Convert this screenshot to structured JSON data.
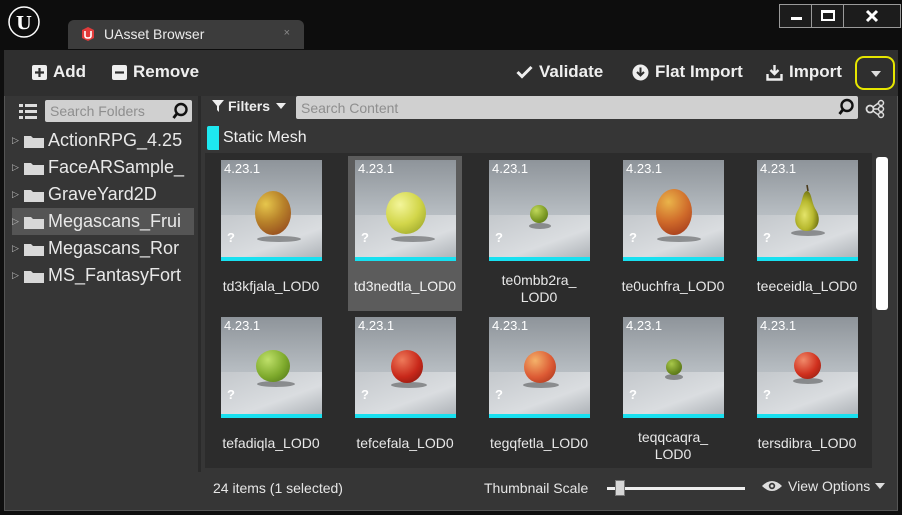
{
  "window": {
    "tab_title": "UAsset Browser",
    "tab_close": "×"
  },
  "toolbar": {
    "add_label": "Add",
    "remove_label": "Remove",
    "validate_label": "Validate",
    "flat_import_label": "Flat Import",
    "import_label": "Import"
  },
  "folders": {
    "search_placeholder": "Search Folders",
    "items": [
      {
        "label": "ActionRPG_4.25"
      },
      {
        "label": "FaceARSample_"
      },
      {
        "label": "GraveYard2D"
      },
      {
        "label": "Megascans_Frui",
        "selected": true
      },
      {
        "label": "Megascans_Ror"
      },
      {
        "label": "MS_FantasyFort"
      }
    ]
  },
  "content": {
    "filters_label": "Filters",
    "search_placeholder": "Search Content",
    "active_filter": "Static Mesh",
    "active_filter_color": "#1ee8f0",
    "assets": [
      {
        "version": "4.23.1",
        "name": "td3kfjala_LOD0",
        "fruit": "mango",
        "selected": false
      },
      {
        "version": "4.23.1",
        "name": "td3nedtla_LOD0",
        "fruit": "yellow-apple",
        "selected": true
      },
      {
        "version": "4.23.1",
        "name": "te0mbb2ra_\nLOD0",
        "fruit": "lime",
        "selected": false
      },
      {
        "version": "4.23.1",
        "name": "te0uchfra_LOD0",
        "fruit": "mango",
        "selected": false
      },
      {
        "version": "4.23.1",
        "name": "teeceidla_LOD0",
        "fruit": "pear",
        "selected": false
      },
      {
        "version": "4.23.1",
        "name": "tefadiqla_LOD0",
        "fruit": "green-apple",
        "selected": false
      },
      {
        "version": "4.23.1",
        "name": "tefcefala_LOD0",
        "fruit": "red-apple",
        "selected": false
      },
      {
        "version": "4.23.1",
        "name": "tegqfetla_LOD0",
        "fruit": "gala-apple",
        "selected": false
      },
      {
        "version": "4.23.1",
        "name": "teqqcaqra_\nLOD0",
        "fruit": "lime",
        "selected": false
      },
      {
        "version": "4.23.1",
        "name": "tersdibra_LOD0",
        "fruit": "red-apple-small",
        "selected": false
      }
    ]
  },
  "status": {
    "item_count": "24 items (1 selected)",
    "thumbnail_scale_label": "Thumbnail Scale",
    "thumbnail_scale_value": 0.06,
    "view_options_label": "View Options"
  }
}
